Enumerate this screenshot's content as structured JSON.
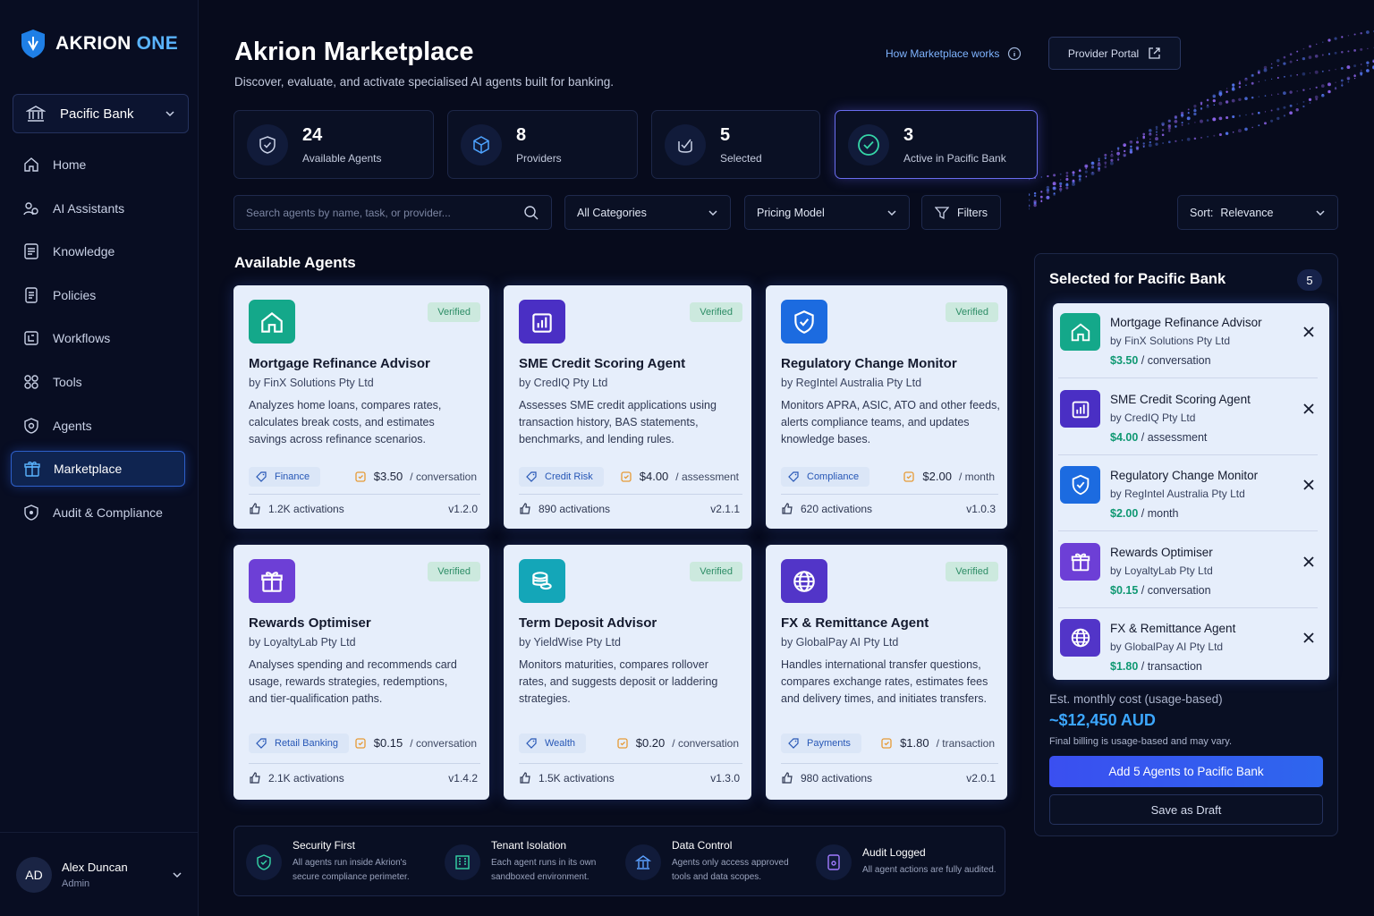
{
  "brand": {
    "name": "AKRION",
    "suffix": "ONE"
  },
  "tenant_selector": {
    "label": "Pacific Bank"
  },
  "nav": [
    {
      "label": "Home",
      "icon": "home-icon"
    },
    {
      "label": "AI Assistants",
      "icon": "assistants-icon"
    },
    {
      "label": "Knowledge",
      "icon": "knowledge-icon"
    },
    {
      "label": "Policies",
      "icon": "policies-icon"
    },
    {
      "label": "Workflows",
      "icon": "workflows-icon"
    },
    {
      "label": "Tools",
      "icon": "tools-icon"
    },
    {
      "label": "Agents",
      "icon": "agents-icon"
    },
    {
      "label": "Marketplace",
      "icon": "gift-icon",
      "active": true
    },
    {
      "label": "Audit & Compliance",
      "icon": "shield-icon"
    }
  ],
  "user": {
    "initials": "AD",
    "name": "Alex Duncan",
    "role": "Admin"
  },
  "header": {
    "title": "Akrion Marketplace",
    "subtitle": "Discover, evaluate, and activate specialised AI agents built for banking.",
    "how_link": "How Marketplace works",
    "portal_button": "Provider Portal"
  },
  "stats": [
    {
      "value": "24",
      "label": "Available Agents"
    },
    {
      "value": "8",
      "label": "Providers"
    },
    {
      "value": "5",
      "label": "Selected"
    },
    {
      "value": "3",
      "label": "Active in Pacific Bank"
    }
  ],
  "filters": {
    "search_placeholder": "Search agents by name, task, or provider...",
    "category": "All Categories",
    "pricing": "Pricing Model",
    "filters_label": "Filters",
    "sort_prefix": "Sort:",
    "sort_value": "Relevance"
  },
  "section_title": "Available Agents",
  "agents": [
    {
      "name": "Mortgage Refinance Advisor",
      "by": "by FinX Solutions Pty Ltd",
      "desc": "Analyzes home loans, compares rates, calculates break costs, and estimates savings across refinance scenarios.",
      "badge": "Verified",
      "tag": "Finance",
      "price": "$3.50",
      "unit": "/ conversation",
      "activations": "1.2K activations",
      "version": "v1.2.0",
      "icon": "home-icon",
      "color": "#14a88a"
    },
    {
      "name": "SME Credit Scoring Agent",
      "by": "by CredIQ Pty Ltd",
      "desc": "Assesses SME credit applications using transaction history, BAS statements, benchmarks, and lending rules.",
      "badge": "Verified",
      "tag": "Credit Risk",
      "price": "$4.00",
      "unit": "/ assessment",
      "activations": "890 activations",
      "version": "v2.1.1",
      "icon": "bar-chart-icon",
      "color": "#4a2fc4"
    },
    {
      "name": "Regulatory Change Monitor",
      "by": "by RegIntel Australia Pty Ltd",
      "desc": "Monitors APRA, ASIC, ATO and other feeds, alerts compliance teams, and updates knowledge bases.",
      "badge": "Verified",
      "tag": "Compliance",
      "price": "$2.00",
      "unit": "/ month",
      "activations": "620 activations",
      "version": "v1.0.3",
      "icon": "shield-check-icon",
      "color": "#1c6be0"
    },
    {
      "name": "Rewards Optimiser",
      "by": "by LoyaltyLab Pty Ltd",
      "desc": "Analyses spending and recommends card usage, rewards strategies, redemptions, and tier-qualification paths.",
      "badge": "Verified",
      "tag": "Retail Banking",
      "price": "$0.15",
      "unit": "/ conversation",
      "activations": "2.1K activations",
      "version": "v1.4.2",
      "icon": "gift-icon",
      "color": "#6d3fd6"
    },
    {
      "name": "Term Deposit Advisor",
      "by": "by YieldWise Pty Ltd",
      "desc": "Monitors maturities, compares rollover rates, and suggests deposit or laddering strategies.",
      "badge": "Verified",
      "tag": "Wealth",
      "price": "$0.20",
      "unit": "/ conversation",
      "activations": "1.5K activations",
      "version": "v1.3.0",
      "icon": "coins-icon",
      "color": "#14a6b8"
    },
    {
      "name": "FX & Remittance Agent",
      "by": "by GlobalPay AI Pty Ltd",
      "desc": "Handles international transfer questions, compares exchange rates, estimates fees and delivery times, and initiates transfers.",
      "badge": "Verified",
      "tag": "Payments",
      "price": "$1.80",
      "unit": "/ transaction",
      "activations": "980 activations",
      "version": "v2.0.1",
      "icon": "globe-icon",
      "color": "#5235c8"
    }
  ],
  "selected_panel": {
    "title": "Selected for Pacific Bank",
    "count": "5",
    "items": [
      {
        "name": "Mortgage Refinance Advisor",
        "by": "by FinX Solutions Pty Ltd",
        "price": "$3.50",
        "unit": "/ conversation",
        "icon": "home-icon",
        "color": "#14a88a"
      },
      {
        "name": "SME Credit Scoring Agent",
        "by": "by CredIQ Pty Ltd",
        "price": "$4.00",
        "unit": "/ assessment",
        "icon": "bar-chart-icon",
        "color": "#4a2fc4"
      },
      {
        "name": "Regulatory Change Monitor",
        "by": "by RegIntel Australia Pty Ltd",
        "price": "$2.00",
        "unit": "/ month",
        "icon": "shield-check-icon",
        "color": "#1c6be0"
      },
      {
        "name": "Rewards Optimiser",
        "by": "by LoyaltyLab Pty Ltd",
        "price": "$0.15",
        "unit": "/ conversation",
        "icon": "gift-icon",
        "color": "#6d3fd6"
      },
      {
        "name": "FX & Remittance Agent",
        "by": "by GlobalPay AI Pty Ltd",
        "price": "$1.80",
        "unit": "/ transaction",
        "icon": "globe-icon",
        "color": "#5235c8"
      }
    ],
    "est_label": "Est. monthly cost (usage-based)",
    "est_value": "~$12,450 AUD",
    "est_note": "Final billing is usage-based and may vary.",
    "add_button": "Add 5 Agents to Pacific Bank",
    "draft_button": "Save as Draft"
  },
  "footer": [
    {
      "title": "Security First",
      "desc": "All agents run inside Akrion's secure compliance perimeter."
    },
    {
      "title": "Tenant Isolation",
      "desc": "Each agent runs in its own sandboxed environment."
    },
    {
      "title": "Data Control",
      "desc": "Agents only access approved tools and data scopes."
    },
    {
      "title": "Audit Logged",
      "desc": "All agent actions are fully audited."
    }
  ]
}
